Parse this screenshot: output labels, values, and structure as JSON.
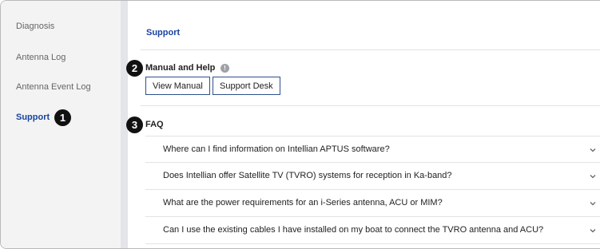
{
  "sidebar": {
    "items": [
      {
        "label": "Diagnosis"
      },
      {
        "label": "Antenna Log"
      },
      {
        "label": "Antenna Event Log"
      },
      {
        "label": "Support",
        "active": true
      }
    ]
  },
  "callouts": [
    "1",
    "2",
    "3"
  ],
  "main": {
    "title": "Support",
    "manual_help": {
      "heading": "Manual and Help",
      "info_icon_glyph": "!",
      "view_manual_label": "View Manual",
      "support_desk_label": "Support Desk"
    },
    "faq": {
      "heading": "FAQ",
      "items": [
        {
          "question": "Where can I find information on Intellian APTUS software?"
        },
        {
          "question": "Does Intellian offer Satellite TV (TVRO) systems for reception in Ka-band?"
        },
        {
          "question": "What are the power requirements for an i-Series antenna, ACU or MIM?"
        },
        {
          "question": "Can I use the existing cables I have installed on my boat to connect the TVRO antenna and ACU?"
        }
      ]
    }
  },
  "colors": {
    "accent": "#1a43a0",
    "button_border": "#2e4f8d",
    "sidebar_bg": "#f3f3f3",
    "gutter": "#e3e5e8"
  }
}
